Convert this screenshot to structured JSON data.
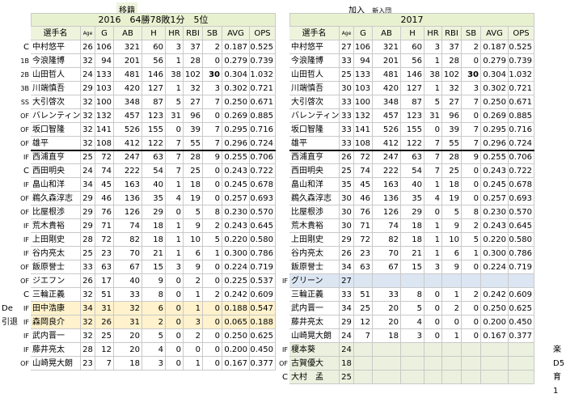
{
  "left": {
    "caption": "移籍",
    "banner": "2016　64勝78敗1分　5位",
    "headers": [
      "選手名",
      "Age",
      "G",
      "AB",
      "H",
      "HR",
      "RBI",
      "SB",
      "AVG",
      "OPS"
    ],
    "rows": [
      {
        "pos": "C",
        "name": "中村悠平",
        "age": "26",
        "g": "106",
        "ab": "321",
        "h": "60",
        "hr": "3",
        "rbi": "37",
        "sb": "2",
        "avg": "0.187",
        "ops": "0.525"
      },
      {
        "pos": "1B",
        "name": "今浪隆博",
        "age": "32",
        "g": "94",
        "ab": "201",
        "h": "56",
        "hr": "1",
        "rbi": "28",
        "sb": "0",
        "avg": "0.279",
        "ops": "0.739"
      },
      {
        "pos": "2B",
        "name": "山田哲人",
        "age": "24",
        "g": "133",
        "ab": "481",
        "h": "146",
        "hr": "38",
        "rbi": "102",
        "sb": "30",
        "avg": "0.304",
        "ops": "1.032"
      },
      {
        "pos": "3B",
        "name": "川端慎吾",
        "age": "29",
        "g": "103",
        "ab": "420",
        "h": "127",
        "hr": "1",
        "rbi": "32",
        "sb": "3",
        "avg": "0.302",
        "ops": "0.721"
      },
      {
        "pos": "SS",
        "name": "大引啓次",
        "age": "32",
        "g": "100",
        "ab": "348",
        "h": "87",
        "hr": "5",
        "rbi": "27",
        "sb": "7",
        "avg": "0.250",
        "ops": "0.671"
      },
      {
        "pos": "OF",
        "name": "バレンティン",
        "age": "32",
        "g": "132",
        "ab": "457",
        "h": "123",
        "hr": "31",
        "rbi": "96",
        "sb": "0",
        "avg": "0.269",
        "ops": "0.885"
      },
      {
        "pos": "OF",
        "name": "坂口智隆",
        "age": "32",
        "g": "141",
        "ab": "526",
        "h": "155",
        "hr": "0",
        "rbi": "39",
        "sb": "7",
        "avg": "0.295",
        "ops": "0.716"
      },
      {
        "pos": "OF",
        "name": "雄平",
        "age": "32",
        "g": "108",
        "ab": "412",
        "h": "122",
        "hr": "7",
        "rbi": "55",
        "sb": "7",
        "avg": "0.296",
        "ops": "0.724"
      },
      {
        "pos": "IF",
        "name": "西浦直亨",
        "age": "25",
        "g": "72",
        "ab": "247",
        "h": "63",
        "hr": "7",
        "rbi": "28",
        "sb": "9",
        "avg": "0.255",
        "ops": "0.706"
      },
      {
        "pos": "C",
        "name": "西田明央",
        "age": "24",
        "g": "74",
        "ab": "222",
        "h": "54",
        "hr": "7",
        "rbi": "25",
        "sb": "0",
        "avg": "0.243",
        "ops": "0.722"
      },
      {
        "pos": "IF",
        "name": "畠山和洋",
        "age": "34",
        "g": "45",
        "ab": "163",
        "h": "40",
        "hr": "1",
        "rbi": "18",
        "sb": "0",
        "avg": "0.245",
        "ops": "0.678"
      },
      {
        "pos": "OF",
        "name": "鵜久森淳志",
        "age": "29",
        "g": "46",
        "ab": "136",
        "h": "35",
        "hr": "4",
        "rbi": "19",
        "sb": "0",
        "avg": "0.257",
        "ops": "0.693"
      },
      {
        "pos": "OF",
        "name": "比屋根渉",
        "age": "29",
        "g": "76",
        "ab": "126",
        "h": "29",
        "hr": "0",
        "rbi": "5",
        "sb": "8",
        "avg": "0.230",
        "ops": "0.570"
      },
      {
        "pos": "IF",
        "name": "荒木貴裕",
        "age": "29",
        "g": "71",
        "ab": "74",
        "h": "18",
        "hr": "1",
        "rbi": "9",
        "sb": "2",
        "avg": "0.243",
        "ops": "0.645"
      },
      {
        "pos": "IF",
        "name": "上田剛史",
        "age": "28",
        "g": "72",
        "ab": "82",
        "h": "18",
        "hr": "1",
        "rbi": "10",
        "sb": "5",
        "avg": "0.220",
        "ops": "0.580"
      },
      {
        "pos": "IF",
        "name": "谷内亮太",
        "age": "25",
        "g": "23",
        "ab": "70",
        "h": "21",
        "hr": "1",
        "rbi": "6",
        "sb": "1",
        "avg": "0.300",
        "ops": "0.786"
      },
      {
        "pos": "OF",
        "name": "飯原誉士",
        "age": "33",
        "g": "63",
        "ab": "67",
        "h": "15",
        "hr": "3",
        "rbi": "9",
        "sb": "0",
        "avg": "0.224",
        "ops": "0.719"
      },
      {
        "pos": "OF",
        "name": "ジエフン",
        "age": "26",
        "g": "17",
        "ab": "40",
        "h": "9",
        "hr": "0",
        "rbi": "2",
        "sb": "0",
        "avg": "0.225",
        "ops": "0.537"
      },
      {
        "pos": "C",
        "name": "三輪正義",
        "age": "32",
        "g": "51",
        "ab": "33",
        "h": "8",
        "hr": "0",
        "rbi": "1",
        "sb": "2",
        "avg": "0.242",
        "ops": "0.609"
      },
      {
        "pos": "IF",
        "name": "田中浩康",
        "age": "34",
        "g": "31",
        "ab": "32",
        "h": "6",
        "hr": "0",
        "rbi": "1",
        "sb": "0",
        "avg": "0.188",
        "ops": "0.547",
        "hl": "y",
        "note": "De"
      },
      {
        "pos": "IF",
        "name": "森岡良介",
        "age": "32",
        "g": "26",
        "ab": "31",
        "h": "2",
        "hr": "0",
        "rbi": "3",
        "sb": "0",
        "avg": "0.065",
        "ops": "0.188",
        "hl": "y",
        "note": "引退"
      },
      {
        "pos": "IF",
        "name": "武内晋一",
        "age": "32",
        "g": "25",
        "ab": "20",
        "h": "5",
        "hr": "0",
        "rbi": "2",
        "sb": "0",
        "avg": "0.250",
        "ops": "0.625"
      },
      {
        "pos": "IF",
        "name": "藤井亮太",
        "age": "28",
        "g": "12",
        "ab": "20",
        "h": "4",
        "hr": "0",
        "rbi": "0",
        "sb": "0",
        "avg": "0.200",
        "ops": "0.450"
      },
      {
        "pos": "OF",
        "name": "山崎晃大朗",
        "age": "23",
        "g": "7",
        "ab": "18",
        "h": "3",
        "hr": "0",
        "rbi": "1",
        "sb": "0",
        "avg": "0.167",
        "ops": "0.377"
      }
    ]
  },
  "right": {
    "caption": "加入",
    "caption_small": "新入団",
    "banner": "2017",
    "headers": [
      "選手名",
      "Age",
      "G",
      "AB",
      "H",
      "HR",
      "RBI",
      "SB",
      "AVG",
      "OPS"
    ],
    "rows": [
      {
        "name": "中村悠平",
        "age": "27",
        "g": "106",
        "ab": "321",
        "h": "60",
        "hr": "3",
        "rbi": "37",
        "sb": "2",
        "avg": "0.187",
        "ops": "0.525"
      },
      {
        "name": "今浪隆博",
        "age": "33",
        "g": "94",
        "ab": "201",
        "h": "56",
        "hr": "1",
        "rbi": "28",
        "sb": "0",
        "avg": "0.279",
        "ops": "0.739"
      },
      {
        "name": "山田哲人",
        "age": "25",
        "g": "133",
        "ab": "481",
        "h": "146",
        "hr": "38",
        "rbi": "102",
        "sb": "30",
        "avg": "0.304",
        "ops": "1.032"
      },
      {
        "name": "川端慎吾",
        "age": "30",
        "g": "103",
        "ab": "420",
        "h": "127",
        "hr": "1",
        "rbi": "32",
        "sb": "3",
        "avg": "0.302",
        "ops": "0.721"
      },
      {
        "name": "大引啓次",
        "age": "33",
        "g": "100",
        "ab": "348",
        "h": "87",
        "hr": "5",
        "rbi": "27",
        "sb": "7",
        "avg": "0.250",
        "ops": "0.671"
      },
      {
        "name": "バレンティン",
        "age": "33",
        "g": "132",
        "ab": "457",
        "h": "123",
        "hr": "31",
        "rbi": "96",
        "sb": "0",
        "avg": "0.269",
        "ops": "0.885"
      },
      {
        "name": "坂口智隆",
        "age": "33",
        "g": "141",
        "ab": "526",
        "h": "155",
        "hr": "0",
        "rbi": "39",
        "sb": "7",
        "avg": "0.295",
        "ops": "0.716"
      },
      {
        "name": "雄平",
        "age": "33",
        "g": "108",
        "ab": "412",
        "h": "122",
        "hr": "7",
        "rbi": "55",
        "sb": "7",
        "avg": "0.296",
        "ops": "0.724"
      },
      {
        "name": "西浦直亨",
        "age": "26",
        "g": "72",
        "ab": "247",
        "h": "63",
        "hr": "7",
        "rbi": "28",
        "sb": "9",
        "avg": "0.255",
        "ops": "0.706"
      },
      {
        "name": "西田明央",
        "age": "25",
        "g": "74",
        "ab": "222",
        "h": "54",
        "hr": "7",
        "rbi": "25",
        "sb": "0",
        "avg": "0.243",
        "ops": "0.722"
      },
      {
        "name": "畠山和洋",
        "age": "35",
        "g": "45",
        "ab": "163",
        "h": "40",
        "hr": "1",
        "rbi": "18",
        "sb": "0",
        "avg": "0.245",
        "ops": "0.678"
      },
      {
        "name": "鵜久森淳志",
        "age": "30",
        "g": "46",
        "ab": "136",
        "h": "35",
        "hr": "4",
        "rbi": "19",
        "sb": "0",
        "avg": "0.257",
        "ops": "0.693"
      },
      {
        "name": "比屋根渉",
        "age": "30",
        "g": "76",
        "ab": "126",
        "h": "29",
        "hr": "0",
        "rbi": "5",
        "sb": "8",
        "avg": "0.230",
        "ops": "0.570"
      },
      {
        "name": "荒木貴裕",
        "age": "30",
        "g": "71",
        "ab": "74",
        "h": "18",
        "hr": "1",
        "rbi": "9",
        "sb": "2",
        "avg": "0.243",
        "ops": "0.645"
      },
      {
        "name": "上田剛史",
        "age": "29",
        "g": "72",
        "ab": "82",
        "h": "18",
        "hr": "1",
        "rbi": "10",
        "sb": "5",
        "avg": "0.220",
        "ops": "0.580"
      },
      {
        "name": "谷内亮太",
        "age": "26",
        "g": "23",
        "ab": "70",
        "h": "21",
        "hr": "1",
        "rbi": "6",
        "sb": "1",
        "avg": "0.300",
        "ops": "0.786"
      },
      {
        "name": "飯原誉士",
        "age": "34",
        "g": "63",
        "ab": "67",
        "h": "15",
        "hr": "3",
        "rbi": "9",
        "sb": "0",
        "avg": "0.224",
        "ops": "0.719"
      },
      {
        "pos": "IF",
        "name": "グリーン",
        "age": "27",
        "hl": "b"
      },
      {
        "name": "三輪正義",
        "age": "33",
        "g": "51",
        "ab": "33",
        "h": "8",
        "hr": "0",
        "rbi": "1",
        "sb": "2",
        "avg": "0.242",
        "ops": "0.609"
      },
      {
        "name": "武内晋一",
        "age": "34",
        "g": "25",
        "ab": "20",
        "h": "5",
        "hr": "0",
        "rbi": "2",
        "sb": "0",
        "avg": "0.250",
        "ops": "0.625"
      },
      {
        "name": "藤井亮太",
        "age": "29",
        "g": "12",
        "ab": "20",
        "h": "4",
        "hr": "0",
        "rbi": "0",
        "sb": "0",
        "avg": "0.200",
        "ops": "0.450"
      },
      {
        "name": "山崎晃大朗",
        "age": "24",
        "g": "7",
        "ab": "18",
        "h": "3",
        "hr": "0",
        "rbi": "1",
        "sb": "0",
        "avg": "0.167",
        "ops": "0.377"
      },
      {
        "pos": "IF",
        "name": "榎本葵",
        "age": "24",
        "hl": "g",
        "note": "楽"
      },
      {
        "pos": "OF",
        "name": "古賀優大",
        "age": "18",
        "hl": "g",
        "note": "D5"
      },
      {
        "pos": "C",
        "name": "大村　孟",
        "age": "25",
        "hl": "g",
        "note": "育1"
      }
    ]
  }
}
